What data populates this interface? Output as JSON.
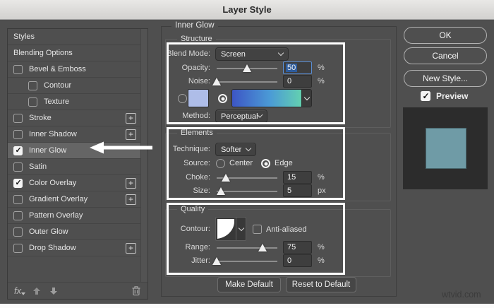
{
  "window": {
    "title": "Layer Style"
  },
  "watermark": "wtvid.com",
  "sidebar": {
    "items": [
      {
        "label": "Styles"
      },
      {
        "label": "Blending Options"
      },
      {
        "label": "Bevel & Emboss",
        "checked": false
      },
      {
        "label": "Contour",
        "checked": false,
        "indent": true
      },
      {
        "label": "Texture",
        "checked": false,
        "indent": true
      },
      {
        "label": "Stroke",
        "checked": false,
        "plus": true
      },
      {
        "label": "Inner Shadow",
        "checked": false,
        "plus": true
      },
      {
        "label": "Inner Glow",
        "checked": true,
        "selected": true
      },
      {
        "label": "Satin",
        "checked": false
      },
      {
        "label": "Color Overlay",
        "checked": true,
        "plus": true
      },
      {
        "label": "Gradient Overlay",
        "checked": false,
        "plus": true
      },
      {
        "label": "Pattern Overlay",
        "checked": false
      },
      {
        "label": "Outer Glow",
        "checked": false
      },
      {
        "label": "Drop Shadow",
        "checked": false,
        "plus": true
      }
    ],
    "toolbar": {
      "fx_label": "fx"
    }
  },
  "main": {
    "title": "Inner Glow"
  },
  "structure": {
    "legend": "Structure",
    "blend_mode": {
      "label": "Blend Mode:",
      "value": "Screen"
    },
    "opacity": {
      "label": "Opacity:",
      "value": "50",
      "unit": "%",
      "percent": 50,
      "focused": true
    },
    "noise": {
      "label": "Noise:",
      "value": "0",
      "unit": "%",
      "percent": 0
    },
    "swatch_radio_selected": false,
    "gradient_radio_selected": true,
    "color_swatch": "#aebde8",
    "gradient": {
      "start": "#3d56c5",
      "mid": "#4b9bd6",
      "end": "#63d0b0"
    },
    "method": {
      "label": "Method:",
      "value": "Perceptual"
    }
  },
  "elements": {
    "legend": "Elements",
    "technique": {
      "label": "Technique:",
      "value": "Softer"
    },
    "source": {
      "label": "Source:",
      "center_label": "Center",
      "edge_label": "Edge",
      "center_selected": false,
      "edge_selected": true
    },
    "choke": {
      "label": "Choke:",
      "value": "15",
      "unit": "%",
      "percent": 15
    },
    "size": {
      "label": "Size:",
      "value": "5",
      "unit": "px",
      "percent": 7
    }
  },
  "quality": {
    "legend": "Quality",
    "contour": {
      "label": "Contour:"
    },
    "anti_aliased": {
      "label": "Anti-aliased",
      "checked": false
    },
    "range": {
      "label": "Range:",
      "value": "75",
      "unit": "%",
      "percent": 75
    },
    "jitter": {
      "label": "Jitter:",
      "value": "0",
      "unit": "%",
      "percent": 0
    }
  },
  "footer": {
    "make_default": "Make Default",
    "reset_to_default": "Reset to Default"
  },
  "actions": {
    "ok": "OK",
    "cancel": "Cancel",
    "new_style": "New Style...",
    "preview_label": "Preview",
    "preview_checked": true
  },
  "preview": {
    "panel_color": "#2c2c2c",
    "swatch_color": "#6f9ba6"
  }
}
